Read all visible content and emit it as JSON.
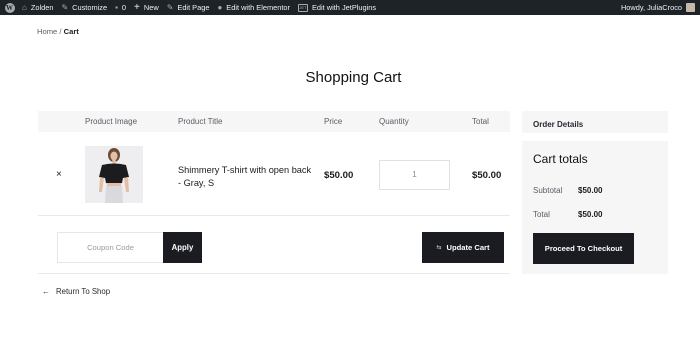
{
  "admin_bar": {
    "site_name": "Zolden",
    "customize": "Customize",
    "comments_count": "0",
    "new": "New",
    "edit_page": "Edit Page",
    "edit_elementor": "Edit with Elementor",
    "edit_jetplugins": "Edit with JetPlugins",
    "jet_badge": "JET",
    "howdy": "Howdy, JuliaCroco"
  },
  "breadcrumb": {
    "home": "Home",
    "separator": " / ",
    "current": "Cart"
  },
  "page_title": "Shopping Cart",
  "cart_table": {
    "headers": {
      "image": "Product Image",
      "title": "Product Title",
      "price": "Price",
      "quantity": "Quantity",
      "total": "Total"
    },
    "items": [
      {
        "remove": "×",
        "title": "Shimmery T-shirt with open back - Gray, S",
        "price": "$50.00",
        "quantity": "1",
        "total": "$50.00"
      }
    ]
  },
  "coupon": {
    "placeholder": "Coupon Code",
    "apply_label": "Apply"
  },
  "update_cart_label": "Update Cart",
  "return_to_shop": "Return To Shop",
  "order_details": {
    "heading": "Order Details",
    "cart_totals_title": "Cart totals",
    "subtotal_label": "Subtotal",
    "subtotal_value": "$50.00",
    "total_label": "Total",
    "total_value": "$50.00",
    "checkout_label": "Proceed To Checkout"
  },
  "colors": {
    "admin_bar": "#1d2327",
    "button": "#1b1b22",
    "panel": "#f6f6f6"
  },
  "icons": [
    "wordpress-icon",
    "home-icon",
    "brush-icon",
    "comment-icon",
    "plus-icon",
    "pencil-icon",
    "elementor-icon",
    "jet-icon",
    "remove-icon",
    "update-icon",
    "arrow-left-icon"
  ]
}
